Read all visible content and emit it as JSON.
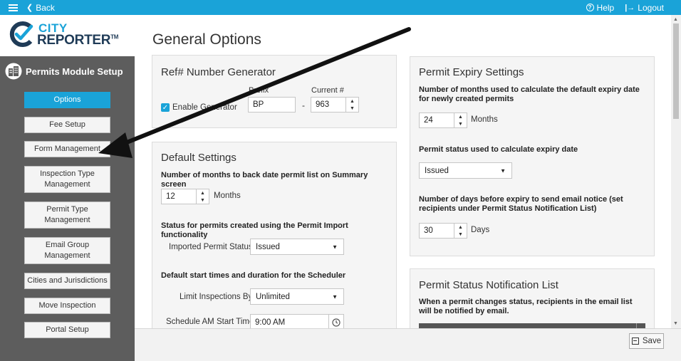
{
  "topbar": {
    "back_label": "Back",
    "help_label": "Help",
    "logout_label": "Logout"
  },
  "logo": {
    "city": "CITY",
    "reporter": "REPORTER",
    "tm": "TM"
  },
  "sidebar": {
    "title": "Permits Module Setup",
    "items": [
      {
        "label": "Options",
        "active": true
      },
      {
        "label": "Fee Setup"
      },
      {
        "label": "Form Management"
      },
      {
        "label": "Inspection Type Management"
      },
      {
        "label": "Permit Type Management"
      },
      {
        "label": "Email Group Management"
      },
      {
        "label": "Cities and Jurisdictions"
      },
      {
        "label": "Move Inspection"
      },
      {
        "label": "Portal Setup"
      }
    ]
  },
  "main": {
    "title": "General Options",
    "ref_generator": {
      "title": "Ref# Number Generator",
      "enable_label": "Enable Generator",
      "enabled": true,
      "prefix_label": "Prefix",
      "prefix_value": "BP",
      "separator": "-",
      "current_label": "Current #",
      "current_value": "963"
    },
    "default_settings": {
      "title": "Default Settings",
      "back_date_label": "Number of months to back date permit list on Summary screen",
      "back_date_value": "12",
      "back_date_unit": "Months",
      "import_status_heading": "Status for permits created using the Permit Import functionality",
      "imported_status_label": "Imported Permit Status",
      "imported_status_value": "Issued",
      "scheduler_heading": "Default start times and duration for the Scheduler",
      "limit_label": "Limit Inspections By",
      "limit_value": "Unlimited",
      "am_start_label": "Schedule AM Start Time",
      "am_start_value": "9:00 AM"
    },
    "expiry": {
      "title": "Permit Expiry Settings",
      "months_label": "Number of months used to calculate the default expiry date for newly created permits",
      "months_value": "24",
      "months_unit": "Months",
      "status_label": "Permit status used to calculate expiry date",
      "status_value": "Issued",
      "days_label": "Number of days before expiry to send email notice (set recipients under Permit Status Notification List)",
      "days_value": "30",
      "days_unit": "Days"
    },
    "notification": {
      "title": "Permit Status Notification List",
      "description": "When a permit changes status, recipients in the email list will be notified by email."
    }
  },
  "footer": {
    "save_label": "Save"
  },
  "colors": {
    "accent": "#1aa3d8",
    "sidebar_bg": "#5d5d5d",
    "navy": "#1f3b57"
  }
}
